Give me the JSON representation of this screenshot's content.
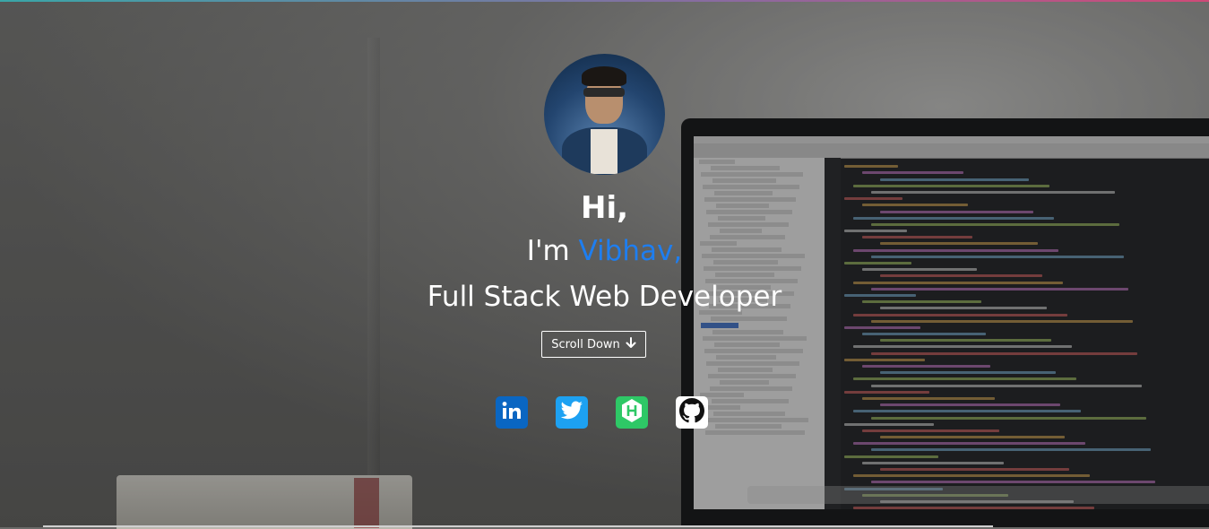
{
  "hero": {
    "greeting": "Hi,",
    "intro_prefix": "I'm ",
    "name": "Vibhav,",
    "role": "Full Stack Web Developer",
    "name_color": "#1e7ef0"
  },
  "scroll_button": {
    "label": "Scroll Down",
    "icon": "arrow-down-icon"
  },
  "social_links": [
    {
      "name": "LinkedIn",
      "icon": "linkedin-icon",
      "color": "#0a66c2"
    },
    {
      "name": "Twitter",
      "icon": "twitter-icon",
      "color": "#1da1f2"
    },
    {
      "name": "HackerRank",
      "icon": "hackerrank-icon",
      "color": "#2ec866"
    },
    {
      "name": "GitHub",
      "icon": "github-icon",
      "color": "#ffffff"
    }
  ]
}
